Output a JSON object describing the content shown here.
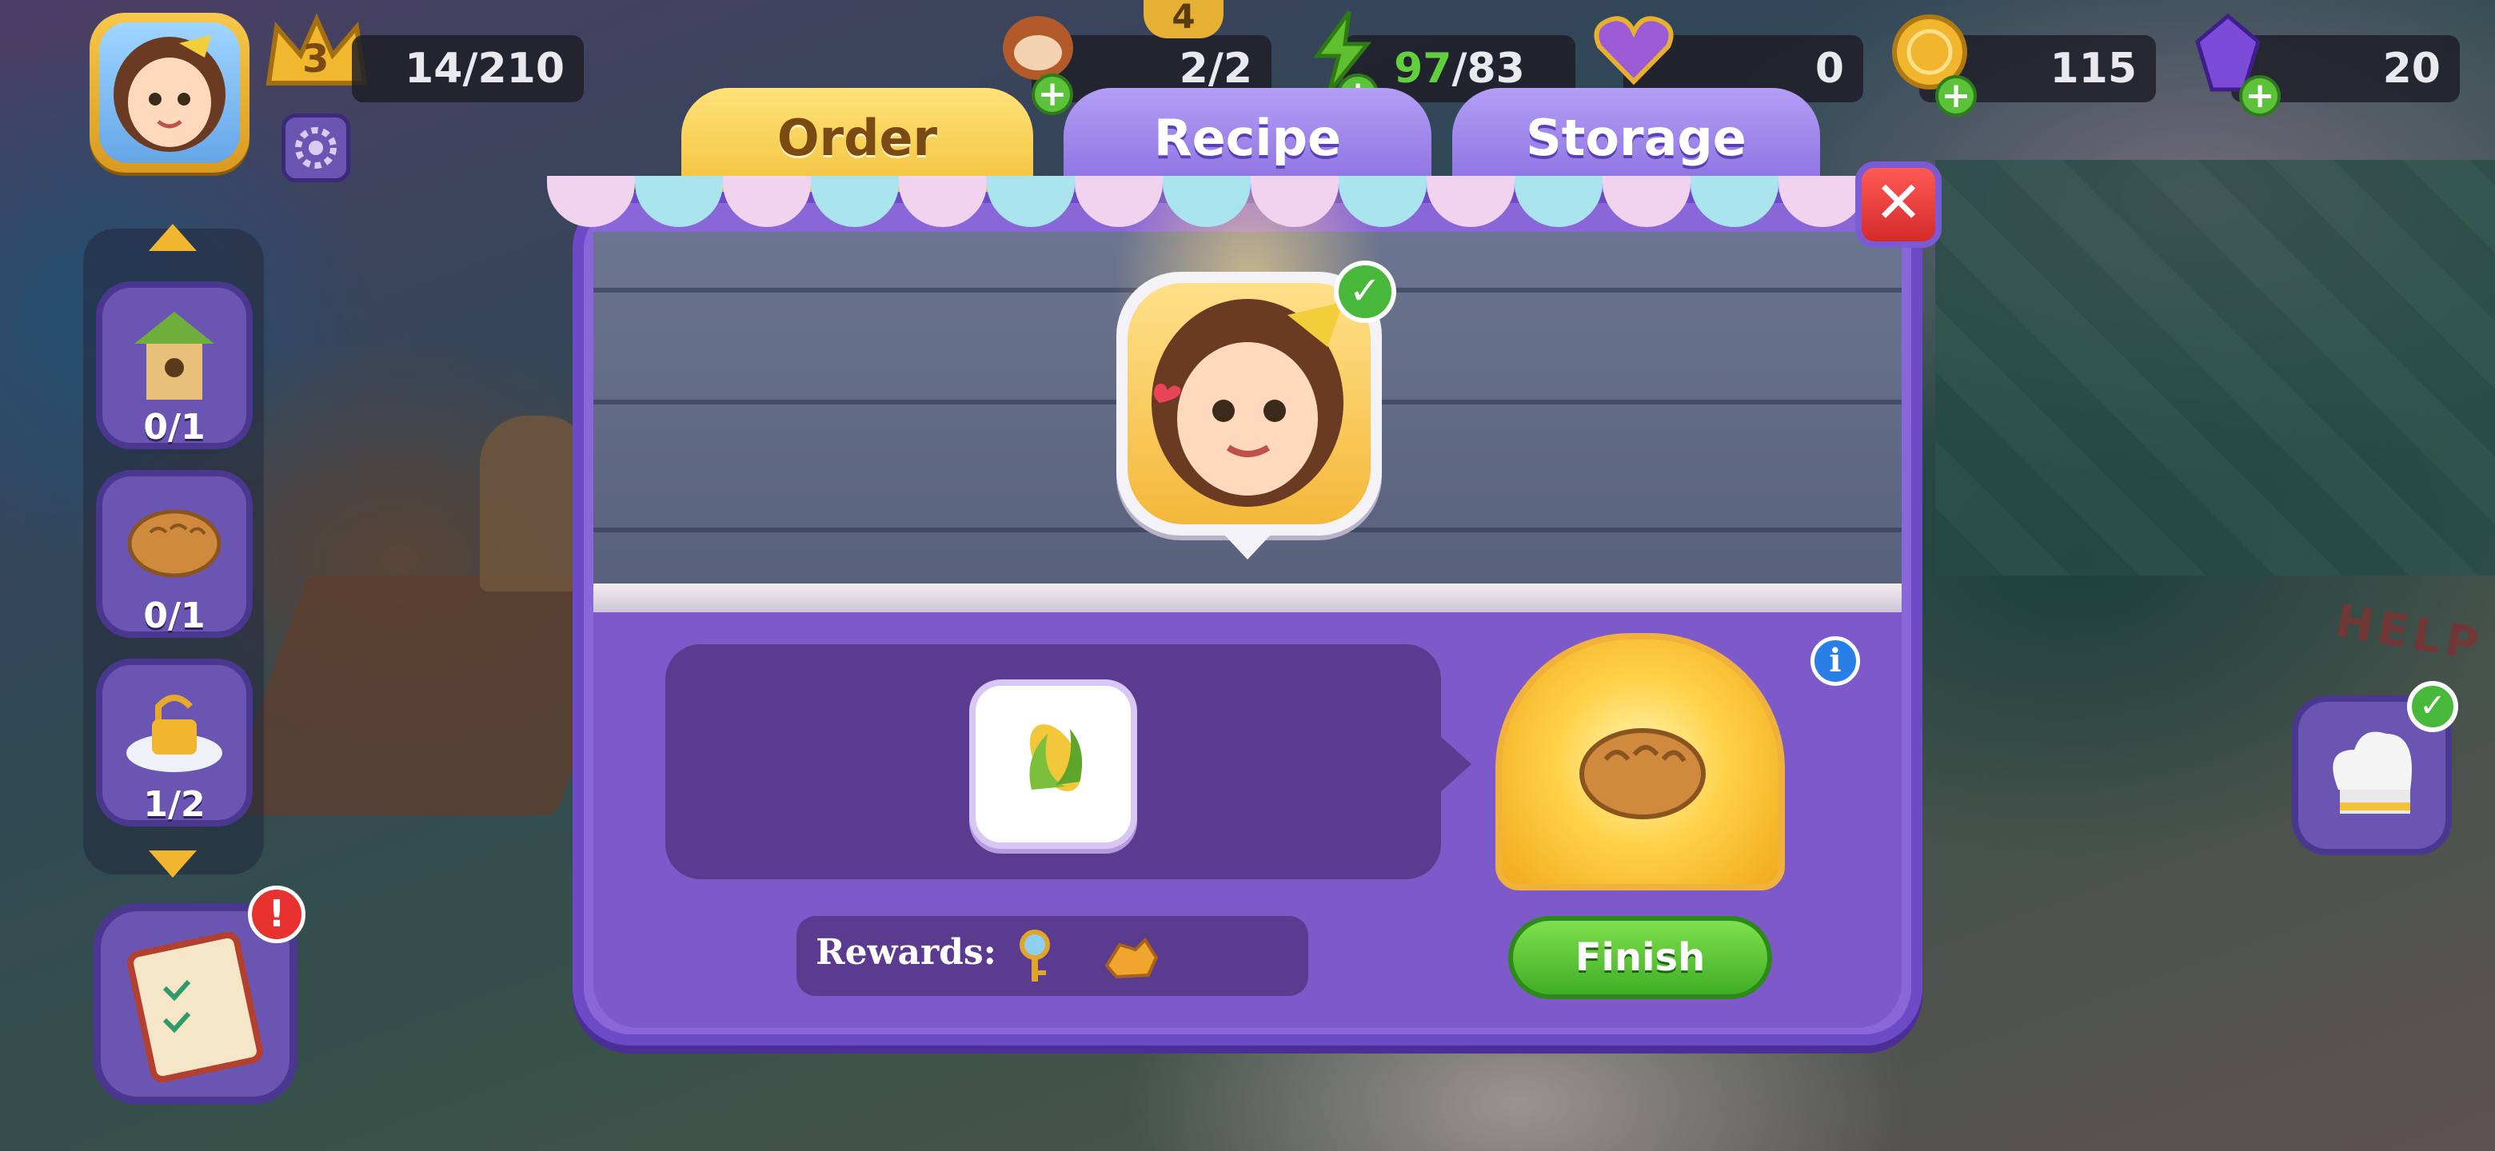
{
  "hud": {
    "level": "3",
    "xp": "14/210",
    "trades": "2/2",
    "trades_badge": "4",
    "energy_current": "97",
    "energy_max": "/83",
    "hearts": "0",
    "coins": "115",
    "gems": "20"
  },
  "left_quests": [
    {
      "icon": "birdhouse-icon",
      "count": "0/1"
    },
    {
      "icon": "bread-icon",
      "count": "0/1"
    },
    {
      "icon": "padlock-icon",
      "count": "1/2"
    }
  ],
  "tabs": {
    "order": "Order",
    "recipe": "Recipe",
    "storage": "Storage"
  },
  "order": {
    "required_item": "corn-icon",
    "result_item": "bread-icon",
    "rewards_label": "Rewards:",
    "rewards": [
      "key-icon",
      "gold-ore-icon"
    ],
    "finish_label": "Finish",
    "info_label": "i"
  },
  "alerts": {
    "tasks_alert": "!"
  },
  "decor": {
    "help_sign": "HELP"
  },
  "colors": {
    "panel": "#8a67d8",
    "finish_button": "#3fae25",
    "close_button": "#d42a2a",
    "active_tab": "#f3c23c"
  }
}
